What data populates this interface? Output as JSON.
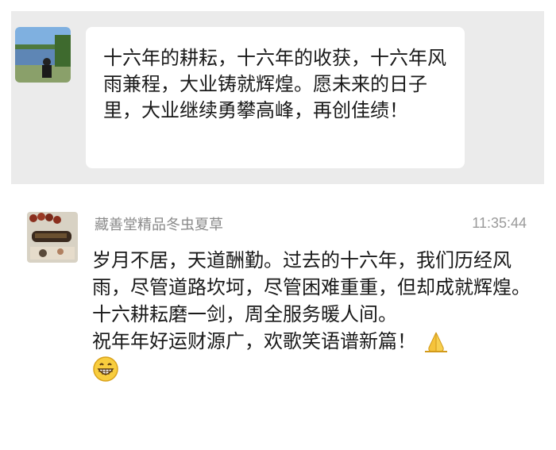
{
  "first_message": {
    "text": "十六年的耕耘，十六年的收获，十六年风雨兼程，大业铸就辉煌。愿未来的日子里，大业继续勇攀高峰，再创佳绩！"
  },
  "second_message": {
    "sender": "藏善堂精品冬虫夏草",
    "time": "11:35:44",
    "paragraph1": "岁月不居，天道酬勤。过去的十六年，我们历经风雨，尽管道路坎坷，尽管困难重重，但却成就辉煌。十六耕耘磨一剑，周全服务暖人间。",
    "paragraph2": "祝年年好运财源广，欢歌笑语谱新篇！",
    "emojis": [
      "pray-hands-icon",
      "grinning-face-icon"
    ]
  },
  "colors": {
    "top_background": "#ebebeb",
    "bubble": "#ffffff",
    "text": "#1a1a1a",
    "meta": "#8a8a8a"
  }
}
